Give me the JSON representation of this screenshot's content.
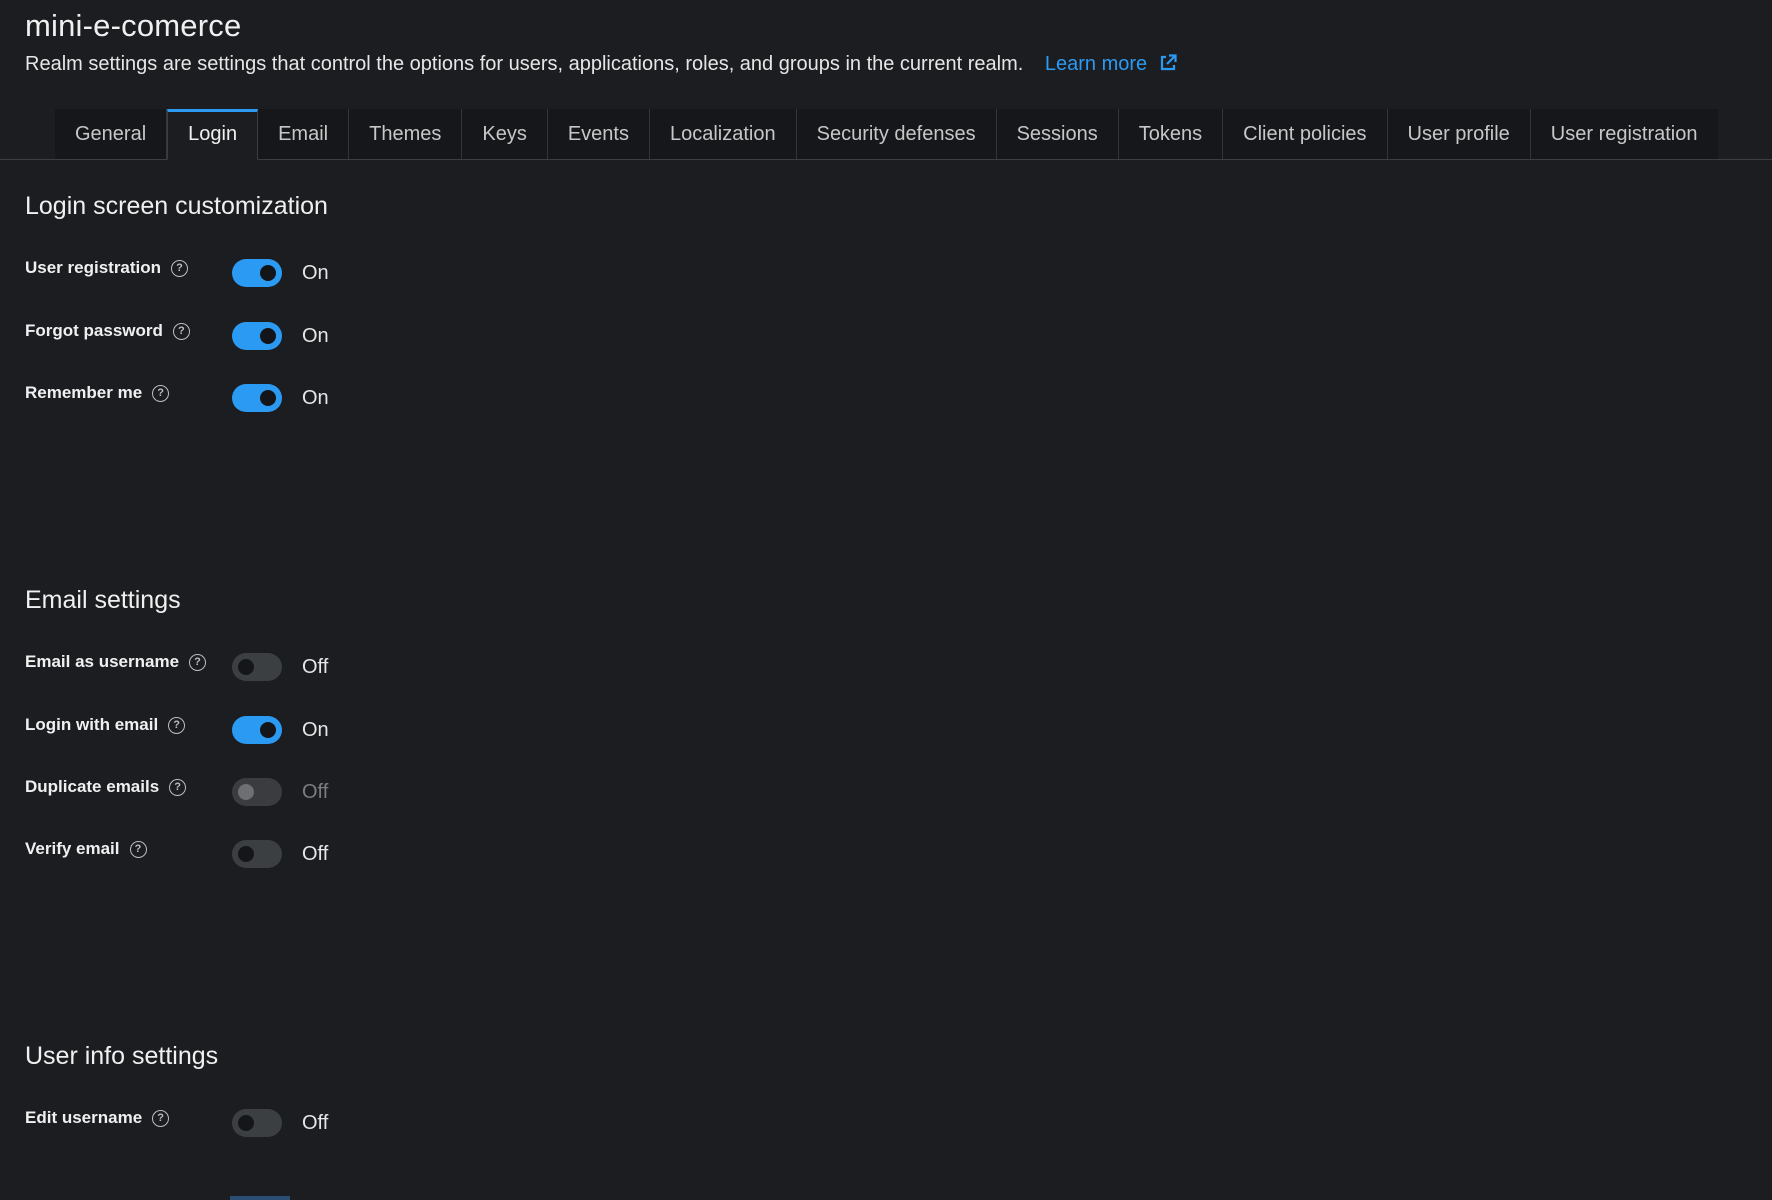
{
  "realm": {
    "title": "mini-e-comerce",
    "description": "Realm settings are settings that control the options for users, applications, roles, and groups in the current realm.",
    "learn_more": "Learn more",
    "link_color": "#2b9af3"
  },
  "tabs": [
    {
      "label": "General"
    },
    {
      "label": "Login"
    },
    {
      "label": "Email"
    },
    {
      "label": "Themes"
    },
    {
      "label": "Keys"
    },
    {
      "label": "Events"
    },
    {
      "label": "Localization"
    },
    {
      "label": "Security defenses"
    },
    {
      "label": "Sessions"
    },
    {
      "label": "Tokens"
    },
    {
      "label": "Client policies"
    },
    {
      "label": "User profile"
    },
    {
      "label": "User registration"
    }
  ],
  "active_tab": "Login",
  "sections": {
    "login": {
      "title": "Login screen customization",
      "rows": [
        {
          "label": "User registration",
          "state": "On",
          "enabled": true
        },
        {
          "label": "Forgot password",
          "state": "On",
          "enabled": true
        },
        {
          "label": "Remember me",
          "state": "On",
          "enabled": true
        }
      ]
    },
    "email": {
      "title": "Email settings",
      "rows": [
        {
          "label": "Email as username",
          "state": "Off",
          "enabled": true
        },
        {
          "label": "Login with email",
          "state": "On",
          "enabled": true
        },
        {
          "label": "Duplicate emails",
          "state": "Off",
          "enabled": false
        },
        {
          "label": "Verify email",
          "state": "Off",
          "enabled": true
        }
      ]
    },
    "userinfo": {
      "title": "User info settings",
      "rows": [
        {
          "label": "Edit username",
          "state": "Off",
          "enabled": true
        }
      ]
    }
  },
  "help_glyph": "?",
  "icons": {
    "help": "help-circle-icon",
    "external_link": "external-link-icon"
  },
  "colors": {
    "background": "#1b1d21",
    "toggle_on": "#2b9af3",
    "toggle_off": "#3c3f42"
  }
}
